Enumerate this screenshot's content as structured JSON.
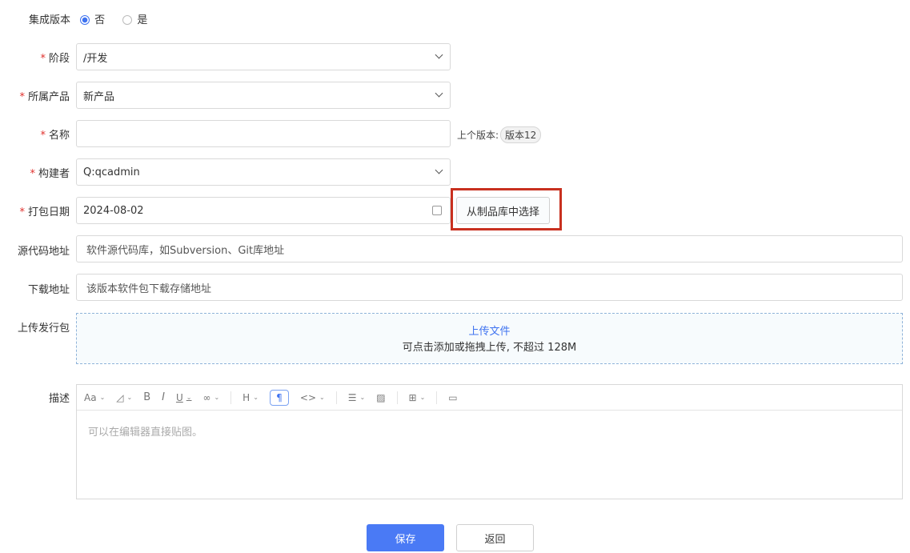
{
  "integrated": {
    "label": "集成版本",
    "options": [
      "否",
      "是"
    ],
    "selected": 0
  },
  "stage": {
    "label": "阶段",
    "value": "/开发"
  },
  "product": {
    "label": "所属产品",
    "value": "新产品"
  },
  "name": {
    "label": "名称",
    "value": "",
    "prev_label": "上个版本:",
    "prev_value": "版本12"
  },
  "builder": {
    "label": "构建者",
    "value": "Q:qcadmin"
  },
  "date": {
    "label": "打包日期",
    "value": "2024-08-02",
    "artifact_button": "从制品库中选择"
  },
  "source": {
    "label": "源代码地址",
    "placeholder": "软件源代码库，如Subversion、Git库地址"
  },
  "download": {
    "label": "下载地址",
    "placeholder": "该版本软件包下载存储地址"
  },
  "upload": {
    "label": "上传发行包",
    "link": "上传文件",
    "hint": "可点击添加或拖拽上传, 不超过 128M"
  },
  "desc": {
    "label": "描述",
    "placeholder": "可以在编辑器直接贴图。"
  },
  "actions": {
    "save": "保存",
    "back": "返回"
  },
  "colors": {
    "primary": "#4a7af5",
    "required": "#e0302c",
    "highlight": "#c8301f"
  }
}
